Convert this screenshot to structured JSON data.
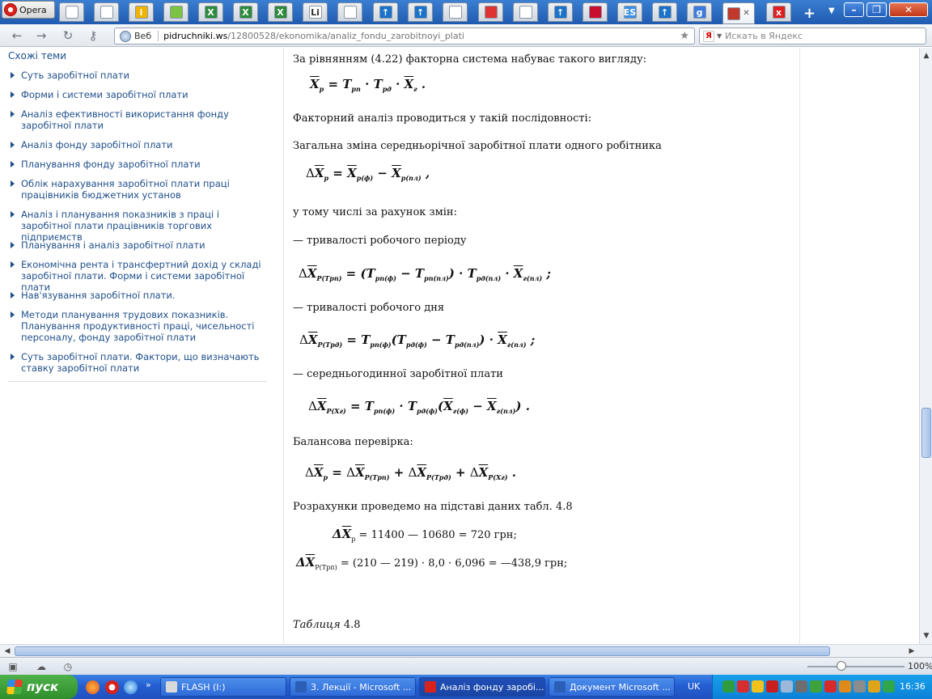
{
  "browser": {
    "menu_label": "Opera",
    "url_label": "Веб",
    "url_host": "pidruchniki.ws",
    "url_path": "/12800528/ekonomika/analiz_fondu_zarobitnoyi_plati",
    "search_placeholder": "Искать в Яндекс",
    "tabs": [
      {
        "icon": "page-icon",
        "color": "#ffffff",
        "glyph": ""
      },
      {
        "icon": "document-icon",
        "color": "#ffffff",
        "glyph": ""
      },
      {
        "icon": "info-icon",
        "color": "#f0b400",
        "glyph": "i"
      },
      {
        "icon": "apple-icon",
        "color": "#7cc243",
        "glyph": ""
      },
      {
        "icon": "excel-icon",
        "color": "#2c8a3a",
        "glyph": "X"
      },
      {
        "icon": "excel-icon",
        "color": "#2c8a3a",
        "glyph": "X"
      },
      {
        "icon": "excel-icon",
        "color": "#2c8a3a",
        "glyph": "X"
      },
      {
        "icon": "li-icon",
        "color": "#ffffff",
        "glyph": "Li"
      },
      {
        "icon": "page-icon",
        "color": "#ffffff",
        "glyph": ""
      },
      {
        "icon": "upload-arrow-icon",
        "color": "#1b73c9",
        "glyph": "↑"
      },
      {
        "icon": "upload-arrow-icon",
        "color": "#1b73c9",
        "glyph": "↑"
      },
      {
        "icon": "document-icon",
        "color": "#ffffff",
        "glyph": ""
      },
      {
        "icon": "red-logo-icon",
        "color": "#d33",
        "glyph": ""
      },
      {
        "icon": "chart-icon",
        "color": "#ffffff",
        "glyph": ""
      },
      {
        "icon": "upload-arrow-icon",
        "color": "#1b73c9",
        "glyph": "↑"
      },
      {
        "icon": "red-chart-icon",
        "color": "#c8102e",
        "glyph": ""
      },
      {
        "icon": "es-icon",
        "color": "#3b8ee0",
        "glyph": "ES"
      },
      {
        "icon": "upload-arrow-icon",
        "color": "#1b73c9",
        "glyph": "↑"
      },
      {
        "icon": "google-icon",
        "color": "#3a7be0",
        "glyph": "g"
      },
      {
        "icon": "books-icon",
        "color": "#c0392b",
        "glyph": ""
      },
      {
        "icon": "red-x-icon",
        "color": "#e02020",
        "glyph": "x"
      }
    ]
  },
  "sidebar": {
    "title": "Схожі теми",
    "items": [
      {
        "label": "Суть заробітної плати"
      },
      {
        "label": "Форми і системи заробітної плати"
      },
      {
        "label": "Аналіз ефективності використання фонду заробітної плати"
      },
      {
        "label": "Аналіз фонду заробітної плати"
      },
      {
        "label": "Планування фонду заробітної плати"
      },
      {
        "label": "Облік нарахування заробітної плати праці працівників бюджетних установ"
      },
      {
        "label": "Аналіз і планування показників з праці і заробітної плати працівників торгових підприємств"
      },
      {
        "label": "Планування і аналіз заробітної плати"
      },
      {
        "label": "Економічна рента і трансфертний дохід у складі заробітної плати. Форми і системи заробітної плати"
      },
      {
        "label": "Нав'язування заробітної плати."
      },
      {
        "label": "Методи планування трудових показників. Планування продуктивності праці, чисельності персоналу, фонду заробітної плати"
      },
      {
        "label": "Суть заробітної плати. Фактори, що визначають ставку заробітної плати"
      }
    ]
  },
  "content": {
    "p1": "За рівнянням (4.22) факторна система набуває такого вигляду:",
    "p2": "Факторний аналіз проводиться у такій послідовності:",
    "p3": "Загальна зміна середньорічної заробітної плати одного робітника",
    "p4": "у тому числі за рахунок змін:",
    "p5": "— тривалості робочого періоду",
    "p6": "— тривалості робочого дня",
    "p7": "— середньогодинної заробітної плати",
    "p8": "Балансова перевірка:",
    "p9": "Розрахунки проведемо на підставі даних табл. 4.8",
    "table_caption": "Таблиця",
    "table_number": "4.8",
    "calc1": "= 11400 — 10680 = 720 грн;",
    "calc2": "= (210 — 219) · 8,0 · 6,096 = —438,9 грн;"
  },
  "statusbar": {
    "zoom": "100%"
  },
  "taskbar": {
    "start_label": "пуск",
    "tasks": [
      {
        "label": "FLASH (I:)",
        "color": "#d9d9d9"
      },
      {
        "label": "3. Лекції - Microsoft ...",
        "color": "#2b5fb7"
      },
      {
        "label": "Аналіз фонду заробі...",
        "color": "#d8221c"
      },
      {
        "label": "Документ Microsoft ...",
        "color": "#2b5fb7"
      }
    ],
    "language": "UK",
    "clock": "16:36"
  }
}
